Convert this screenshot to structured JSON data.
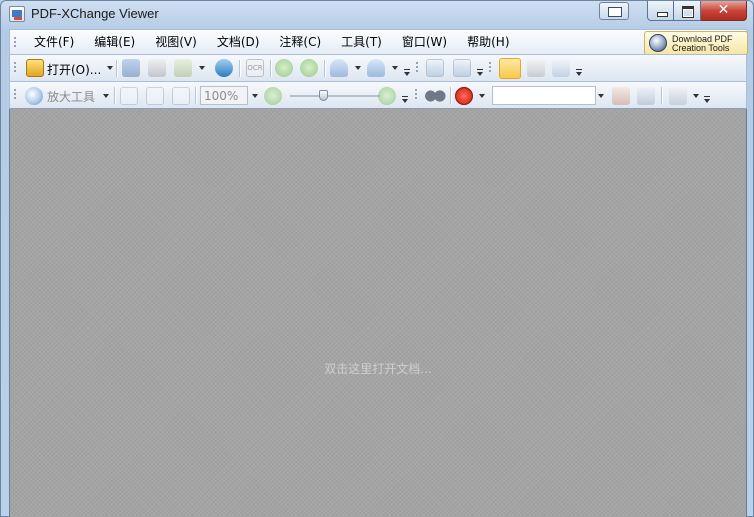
{
  "window": {
    "title": "PDF-XChange Viewer",
    "close_glyph": "✕"
  },
  "menu": {
    "items": [
      {
        "label": "文件(F)"
      },
      {
        "label": "编辑(E)"
      },
      {
        "label": "视图(V)"
      },
      {
        "label": "文档(D)"
      },
      {
        "label": "注释(C)"
      },
      {
        "label": "工具(T)"
      },
      {
        "label": "窗口(W)"
      },
      {
        "label": "帮助(H)"
      }
    ],
    "download_line1": "Download PDF",
    "download_line2": "Creation Tools"
  },
  "toolbar1": {
    "open_label": "打开(O)...",
    "ocr_label": "OCR"
  },
  "toolbar2": {
    "zoom_tool_label": "放大工具",
    "zoom_value": "100%",
    "zoom_level": 0.36,
    "search_value": ""
  },
  "document": {
    "hint": "双击这里打开文档..."
  },
  "colors": {
    "accent": "#3f79c9",
    "hand_tool_active": "#f7c94b",
    "close_red": "#c8473a"
  }
}
